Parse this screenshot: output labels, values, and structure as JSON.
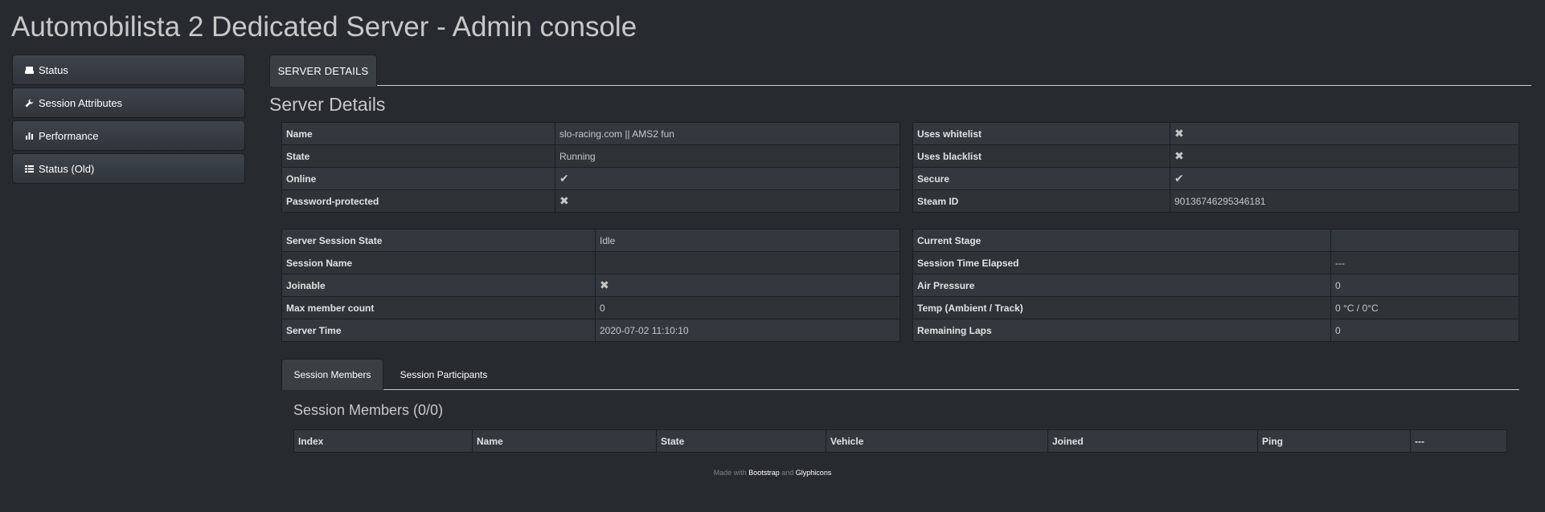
{
  "header": {
    "title": "Automobilista 2 Dedicated Server - Admin console"
  },
  "sidebar": {
    "items": [
      {
        "label": "Status",
        "icon": "hdd-icon"
      },
      {
        "label": "Session Attributes",
        "icon": "wrench-icon"
      },
      {
        "label": "Performance",
        "icon": "stats-icon"
      },
      {
        "label": "Status (Old)",
        "icon": "list-icon"
      }
    ]
  },
  "tabs": {
    "server_details": "SERVER DETAILS"
  },
  "server_details": {
    "title": "Server Details",
    "left": [
      {
        "label": "Name",
        "value": "slo-racing.com || AMS2 fun"
      },
      {
        "label": "State",
        "value": "Running"
      },
      {
        "label": "Online",
        "value": "✔"
      },
      {
        "label": "Password-protected",
        "value": "✖"
      }
    ],
    "right": [
      {
        "label": "Uses whitelist",
        "value": "✖"
      },
      {
        "label": "Uses blacklist",
        "value": "✖"
      },
      {
        "label": "Secure",
        "value": "✔"
      },
      {
        "label": "Steam ID",
        "value": "90136746295346181"
      }
    ]
  },
  "session": {
    "left": [
      {
        "label": "Server Session State",
        "value": "Idle"
      },
      {
        "label": "Session Name",
        "value": ""
      },
      {
        "label": "Joinable",
        "value": "✖"
      },
      {
        "label": "Max member count",
        "value": "0"
      },
      {
        "label": "Server Time",
        "value": "2020-07-02 11:10:10"
      }
    ],
    "right": [
      {
        "label": "Current Stage",
        "value": ""
      },
      {
        "label": "Session Time Elapsed",
        "value": "---"
      },
      {
        "label": "Air Pressure",
        "value": "0"
      },
      {
        "label": "Temp (Ambient / Track)",
        "value": "0 °C / 0°C"
      },
      {
        "label": "Remaining Laps",
        "value": "0"
      }
    ]
  },
  "sub_tabs": {
    "members": "Session Members",
    "participants": "Session Participants"
  },
  "members": {
    "title": "Session Members (0/0)",
    "columns": [
      "Index",
      "Name",
      "State",
      "Vehicle",
      "Joined",
      "Ping",
      "---"
    ]
  },
  "footer": {
    "prefix": "Made with",
    "link1": "Bootstrap",
    "middle": "and",
    "link2": "Glyphicons"
  }
}
